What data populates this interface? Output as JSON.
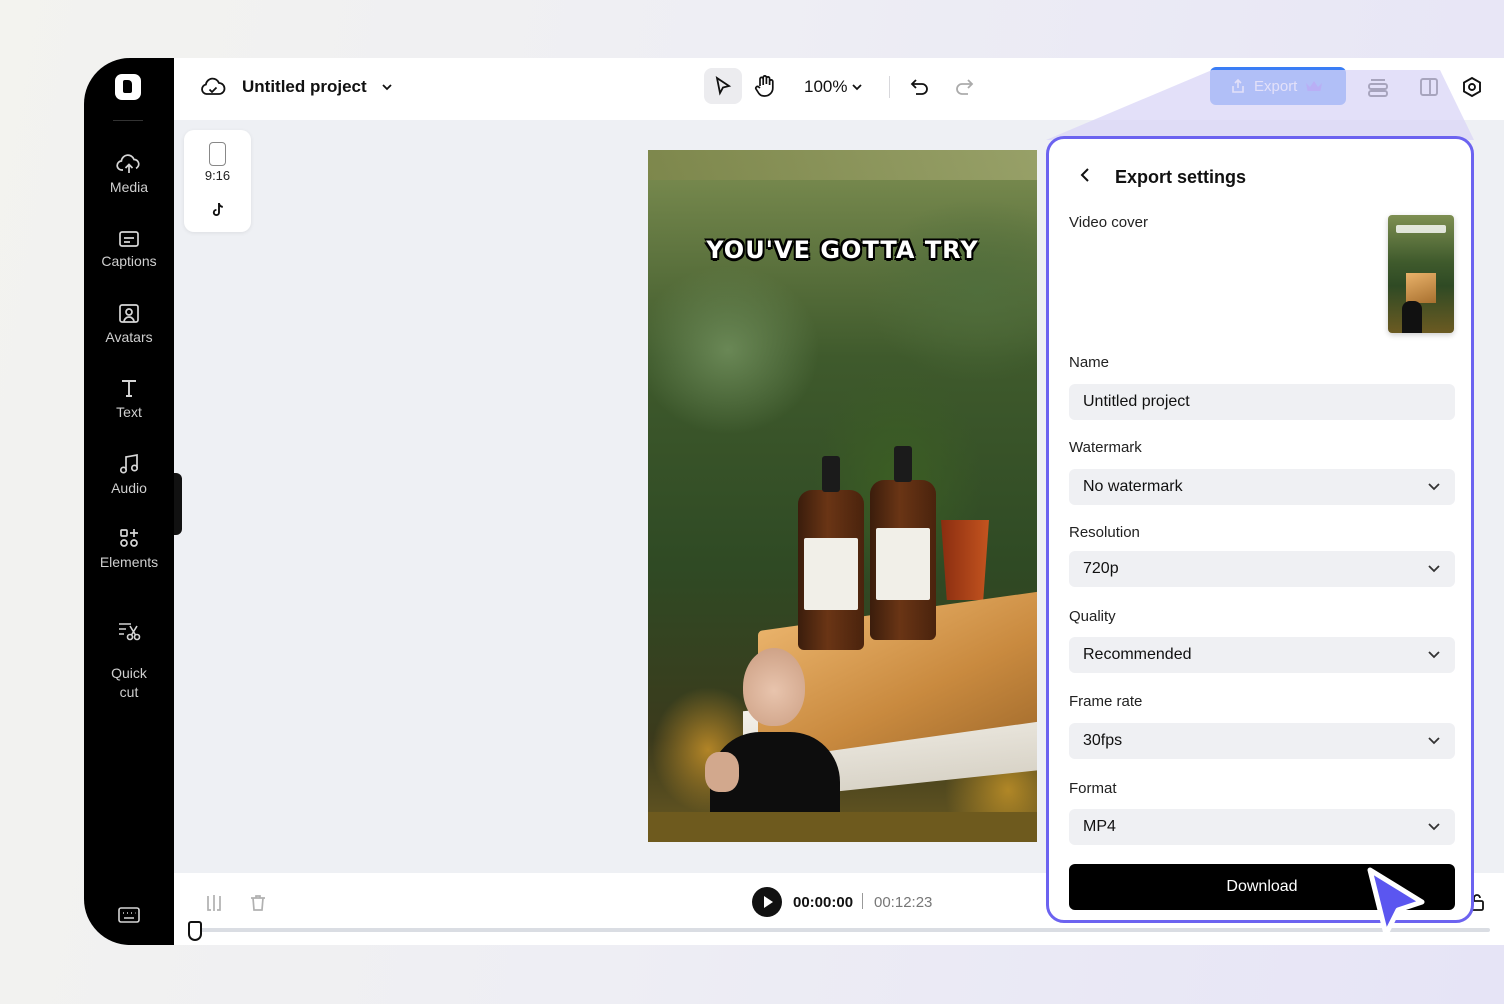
{
  "sidebar": {
    "items": [
      {
        "label": "Media",
        "icon": "cloud-upload-icon"
      },
      {
        "label": "Captions",
        "icon": "captions-icon"
      },
      {
        "label": "Avatars",
        "icon": "avatar-icon"
      },
      {
        "label": "Text",
        "icon": "text-icon"
      },
      {
        "label": "Audio",
        "icon": "music-note-icon"
      },
      {
        "label": "Elements",
        "icon": "elements-icon"
      },
      {
        "label": "Quick\ncut",
        "icon": "scissors-icon"
      }
    ],
    "keyboard_icon": "keyboard-icon"
  },
  "topbar": {
    "project_title": "Untitled project",
    "zoom": "100%",
    "export_label": "Export"
  },
  "ratio": {
    "label": "9:16"
  },
  "canvas": {
    "caption": "YOU'VE GOTTA TRY"
  },
  "timeline": {
    "current_time": "00:00:00",
    "total_time": "00:12:23"
  },
  "export_panel": {
    "title": "Export settings",
    "video_cover_label": "Video cover",
    "name_label": "Name",
    "name_value": "Untitled project",
    "watermark_label": "Watermark",
    "watermark_value": "No watermark",
    "resolution_label": "Resolution",
    "resolution_value": "720p",
    "quality_label": "Quality",
    "quality_value": "Recommended",
    "framerate_label": "Frame rate",
    "framerate_value": "30fps",
    "format_label": "Format",
    "format_value": "MP4",
    "download_label": "Download"
  },
  "colors": {
    "accent": "#3a7df5",
    "panel_border": "#6c63f0",
    "sidebar_bg": "#000000",
    "cursor": "#5b56f0"
  }
}
